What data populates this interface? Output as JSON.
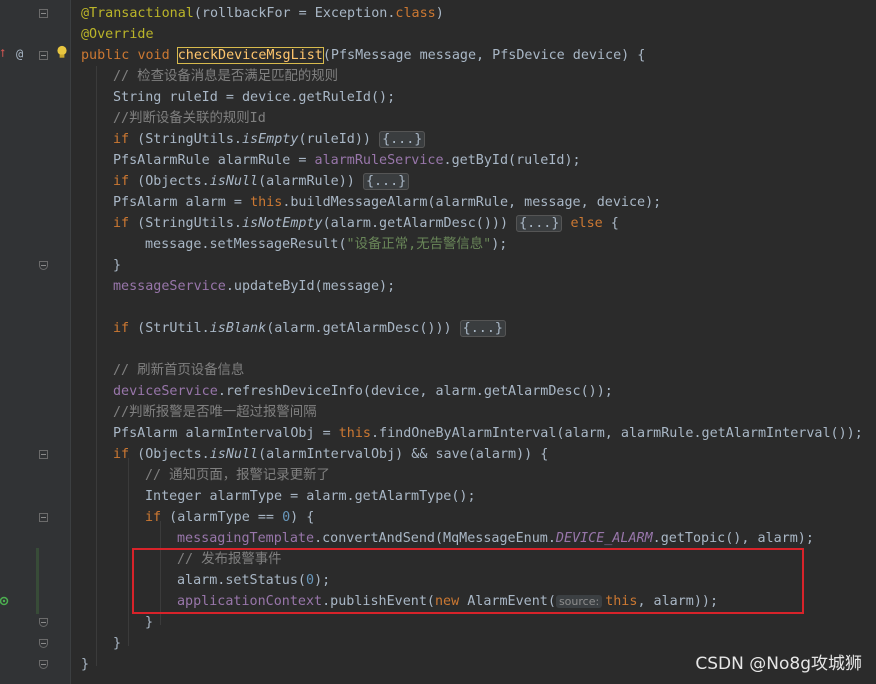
{
  "gutter": {
    "override_marker_icon": "override-arrow-icon",
    "annotation_marker": "@",
    "intention_bulb_icon": "lightbulb-icon",
    "event_marker_icon": "event-listener-icon"
  },
  "code": {
    "l1_annotation": "@Transactional",
    "l1_rest": "(rollbackFor = Exception.",
    "l1_class": "class",
    "l1_close": ")",
    "l2_annotation": "@Override",
    "l3_public": "public",
    "l3_void": "void",
    "l3_method": "checkDeviceMsgList",
    "l3_params": "(PfsMessage message, PfsDevice device) {",
    "l4_comment": "// 检查设备消息是否满足匹配的规则",
    "l5_text": "String ruleId = device.getRuleId();",
    "l6_comment": "//判断设备关联的规则Id",
    "l7_if": "if",
    "l7_a": " (StringUtils.",
    "l7_static": "isEmpty",
    "l7_b": "(ruleId)) ",
    "l7_fold": "{...}",
    "l8_a": "PfsAlarmRule alarmRule = ",
    "l8_field": "alarmRuleService",
    "l8_b": ".getById(ruleId);",
    "l9_if": "if",
    "l9_a": " (Objects.",
    "l9_static": "isNull",
    "l9_b": "(alarmRule)) ",
    "l9_fold": "{...}",
    "l10_a": "PfsAlarm alarm = ",
    "l10_this": "this",
    "l10_b": ".buildMessageAlarm(alarmRule, message, device);",
    "l11_if": "if",
    "l11_a": " (StringUtils.",
    "l11_static": "isNotEmpty",
    "l11_b": "(alarm.getAlarmDesc())) ",
    "l11_fold": "{...}",
    "l11_else": "else",
    "l11_c": " {",
    "l12_a": "message.setMessageResult(",
    "l12_str": "\"设备正常,无告警信息\"",
    "l12_b": ");",
    "l13_brace": "}",
    "l14_field": "messageService",
    "l14_b": ".updateById(message);",
    "l16_if": "if",
    "l16_a": " (StrUtil.",
    "l16_static": "isBlank",
    "l16_b": "(alarm.getAlarmDesc())) ",
    "l16_fold": "{...}",
    "l18_comment": "// 刷新首页设备信息",
    "l19_field": "deviceService",
    "l19_b": ".refreshDeviceInfo(device, alarm.getAlarmDesc());",
    "l20_comment": "//判断报警是否唯一超过报警间隔",
    "l21_a": "PfsAlarm alarmIntervalObj = ",
    "l21_this": "this",
    "l21_b": ".findOneByAlarmInterval(alarm, alarmRule.getAlarmInterval());",
    "l22_if": "if",
    "l22_a": " (Objects.",
    "l22_static": "isNull",
    "l22_b": "(alarmIntervalObj) && save(alarm)) {",
    "l23_comment": "// 通知页面，报警记录更新了",
    "l24_text": "Integer alarmType = alarm.getAlarmType();",
    "l25_if": "if",
    "l25_a": " (alarmType == ",
    "l25_num": "0",
    "l25_b": ") {",
    "l26_field": "messagingTemplate",
    "l26_a": ".convertAndSend(MqMessageEnum.",
    "l26_const": "DEVICE_ALARM",
    "l26_b": ".getTopic(), alarm);",
    "l27_comment": "// 发布报警事件",
    "l28_a": "alarm.setStatus(",
    "l28_num": "0",
    "l28_b": ");",
    "l29_field": "applicationContext",
    "l29_a": ".publishEvent(",
    "l29_new": "new",
    "l29_b": " AlarmEvent(",
    "l29_hint": "source:",
    "l29_this": "this",
    "l29_c": ", alarm));",
    "l30_brace": "}",
    "l31_brace": "}",
    "l32_brace": "}"
  },
  "watermark": "CSDN @No8g攻城狮",
  "colors": {
    "background": "#2b2b2b",
    "keyword": "#cc7832",
    "annotation": "#bbb529",
    "comment": "#808080",
    "string": "#6a8759",
    "number": "#6897bb",
    "field": "#9876aa",
    "method_decl": "#ffc66d",
    "highlight_box": "#d8232a"
  }
}
